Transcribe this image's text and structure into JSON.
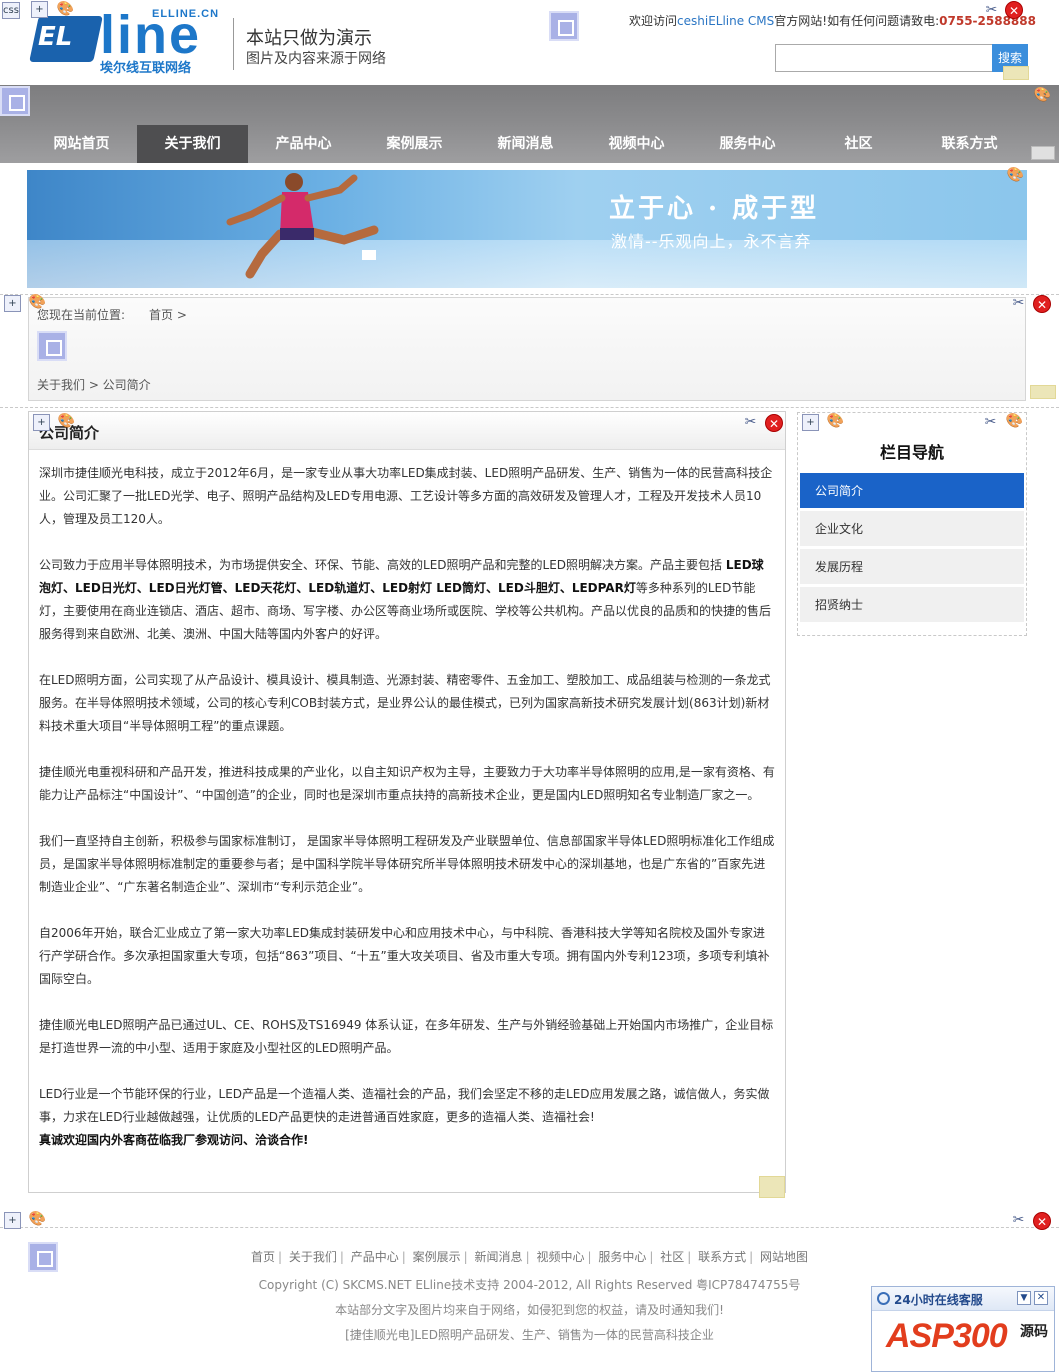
{
  "header": {
    "logo_el": "EL",
    "logo_line": "line",
    "logo_domain": "ELLINE.CN",
    "logo_cn": "埃尔线互联网络",
    "demo_line1": "本站只做为演示",
    "demo_line2": "图片及内容来源于网络",
    "welcome_prefix": "欢迎访问",
    "welcome_link": "ceshiELline CMS",
    "welcome_middle": "官方网站!如有任何问题请致电:",
    "welcome_phone": "0755-2588888",
    "search_placeholder": "",
    "search_button": "搜索"
  },
  "nav": {
    "items": [
      {
        "label": "网站首页"
      },
      {
        "label": "关于我们",
        "active": true
      },
      {
        "label": "产品中心"
      },
      {
        "label": "案例展示"
      },
      {
        "label": "新闻消息"
      },
      {
        "label": "视频中心"
      },
      {
        "label": "服务中心"
      },
      {
        "label": "社区"
      },
      {
        "label": "联系方式"
      }
    ]
  },
  "banner": {
    "line1": "立于心 · 成于型",
    "line2": "激情--乐观向上，永不言弃"
  },
  "breadcrumb": {
    "label": "您现在当前位置:",
    "home": "首页 >",
    "path": "关于我们 > 公司简介"
  },
  "article": {
    "title": "公司简介",
    "p1": "深圳市捷佳顺光电科技，成立于2012年6月，是一家专业从事大功率LED集成封装、LED照明产品研发、生产、销售为一体的民营高科技企业。公司汇聚了一批LED光学、电子、照明产品结构及LED专用电源、工艺设计等多方面的高效研发及管理人才，工程及开发技术人员10人，管理及员工120人。",
    "p2a": "公司致力于应用半导体照明技术，为市场提供安全、环保、节能、高效的LED照明产品和完整的LED照明解决方案。产品主要包括 ",
    "p2b": "LED球泡灯、LED日光灯、LED日光灯管、LED天花灯、LED轨道灯、LED射灯 LED筒灯、LED斗胆灯、LEDPAR灯",
    "p2c": "等多种系列的LED节能灯，主要使用在商业连锁店、酒店、超市、商场、写字楼、办公区等商业场所或医院、学校等公共机构。产品以优良的品质和的快捷的售后服务得到来自欧洲、北美、澳洲、中国大陆等国内外客户的好评。",
    "p3": "在LED照明方面，公司实现了从产品设计、模具设计、模具制造、光源封装、精密零件、五金加工、塑胶加工、成品组装与检测的一条龙式服务。在半导体照明技术领域，公司的核心专利COB封装方式，是业界公认的最佳模式，已列为国家高新技术研究发展计划(863计划)新材料技术重大项目“半导体照明工程”的重点课题。",
    "p4": "捷佳顺光电重视科研和产品开发，推进科技成果的产业化，以自主知识产权为主导，主要致力于大功率半导体照明的应用,是一家有资格、有能力让产品标注“中国设计”、“中国创造”的企业，同时也是深圳市重点扶持的高新技术企业，更是国内LED照明知名专业制造厂家之一。",
    "p5": "我们一直坚持自主创新，积极参与国家标准制订， 是国家半导体照明工程研发及产业联盟单位、信息部国家半导体LED照明标准化工作组成员，是国家半导体照明标准制定的重要参与者；是中国科学院半导体研究所半导体照明技术研发中心的深圳基地，也是广东省的”百家先进制造业企业”、“广东著名制造企业”、深圳市“专利示范企业”。",
    "p6": "自2006年开始，联合汇业成立了第一家大功率LED集成封装研发中心和应用技术中心，与中科院、香港科技大学等知名院校及国外专家进行产学研合作。多次承担国家重大专项，包括“863”项目、“十五”重大攻关项目、省及市重大专项。拥有国内外专利123项，多项专利填补国际空白。",
    "p7": "捷佳顺光电LED照明产品已通过UL、CE、ROHS及TS16949 体系认证，在多年研发、生产与外销经验基础上开始国内市场推广，企业目标是打造世界一流的中小型、适用于家庭及小型社区的LED照明产品。",
    "p8": "LED行业是一个节能环保的行业，LED产品是一个造福人类、造福社会的产品，我们会坚定不移的走LED应用发展之路，诚信做人，务实做事，力求在LED行业越做越强，让优质的LED产品更快的走进普通百姓家庭，更多的造福人类、造福社会!",
    "p9": "真诚欢迎国内外客商莅临我厂参观访问、洽谈合作!"
  },
  "sidebar": {
    "title": "栏目导航",
    "items": [
      {
        "label": "公司简介",
        "active": true
      },
      {
        "label": "企业文化"
      },
      {
        "label": "发展历程"
      },
      {
        "label": "招贤纳士"
      }
    ]
  },
  "footer": {
    "links": [
      "首页",
      "关于我们",
      "产品中心",
      "案例展示",
      "新闻消息",
      "视频中心",
      "服务中心",
      "社区",
      "联系方式",
      "网站地图"
    ],
    "copyright": "Copyright (C) SKCMS.NET ELline技术支持  2004-2012, All Rights Reserved 粤ICP78474755号",
    "notice": "本站部分文字及图片均来自于网络，如侵犯到您的权益，请及时通知我们!",
    "slogan": "[捷佳顺光电]LED照明产品研发、生产、销售为一体的民营高科技企业"
  },
  "chat": {
    "title": "24小时在线客服",
    "logo": "ASP300",
    "logo_cn": "源码"
  },
  "colors": {
    "accent": "#1d77c9",
    "nav_active": "#4e4e50",
    "sidebar_active": "#1a63c8",
    "phone": "#c0392b"
  }
}
